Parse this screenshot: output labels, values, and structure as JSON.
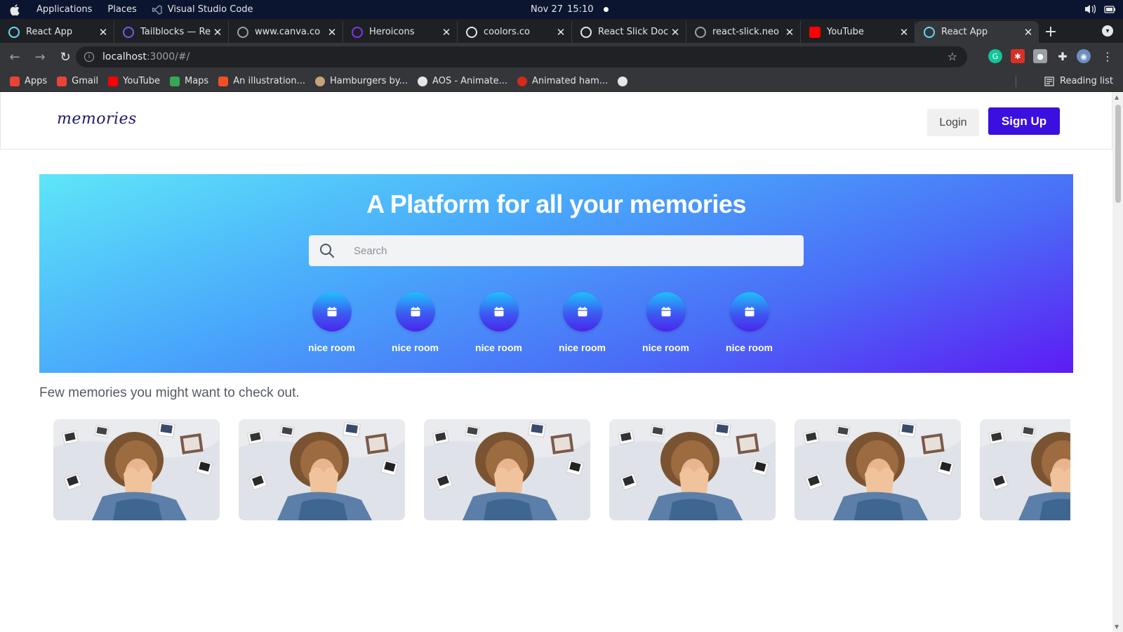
{
  "os": {
    "menu": [
      "Applications",
      "Places",
      "Visual Studio Code"
    ],
    "date": "Nov 27",
    "time": "15:10"
  },
  "browser": {
    "tabs": [
      {
        "title": "React App",
        "icon": "react-icon",
        "color": "#61dafb",
        "active": false
      },
      {
        "title": "Tailblocks — Re",
        "icon": "tailblocks-icon",
        "color": "#6d5ef0",
        "active": false
      },
      {
        "title": "www.canva.co",
        "icon": "canva-icon",
        "color": "#9aa0a6",
        "active": false
      },
      {
        "title": "Heroicons",
        "icon": "heroicons-icon",
        "color": "#7c3aed",
        "active": false
      },
      {
        "title": "coolors.co",
        "icon": "coolors-icon",
        "color": "#e6e6e6",
        "active": false
      },
      {
        "title": "React Slick Doc",
        "icon": "globe-icon",
        "color": "#e6e6e6",
        "active": false
      },
      {
        "title": "react-slick.neo",
        "icon": "globe-icon",
        "color": "#9aa0a6",
        "active": false
      },
      {
        "title": "YouTube",
        "icon": "youtube-icon",
        "color": "#ff0000",
        "active": false
      },
      {
        "title": "React App",
        "icon": "react-icon",
        "color": "#61dafb",
        "active": true
      }
    ],
    "url_host": "localhost",
    "url_path": ":3000/#/",
    "bookmarks": [
      {
        "label": "Apps",
        "icon": "apps-grid-icon",
        "color": "#ea4335"
      },
      {
        "label": "Gmail",
        "icon": "gmail-icon",
        "color": "#ea4335"
      },
      {
        "label": "YouTube",
        "icon": "youtube-icon",
        "color": "#ff0000"
      },
      {
        "label": "Maps",
        "icon": "maps-icon",
        "color": "#34a853"
      },
      {
        "label": "An illustration...",
        "icon": "microsoft-icon",
        "color": "#f25022"
      },
      {
        "label": "Hamburgers by...",
        "icon": "hamburger-site-icon",
        "color": "#c9a27a"
      },
      {
        "label": "AOS - Animate...",
        "icon": "globe-icon",
        "color": "#e6e6e6"
      },
      {
        "label": "Animated ham...",
        "icon": "animated-ham-icon",
        "color": "#d62a1a"
      },
      {
        "label": "",
        "icon": "globe-icon",
        "color": "#e6e6e6"
      }
    ],
    "reading_list": "Reading list"
  },
  "site": {
    "logo": "memories",
    "login": "Login",
    "signup": "Sign Up",
    "hero_title": "A Platform for all your memories",
    "search_placeholder": "Search",
    "rooms": [
      "nice room",
      "nice room",
      "nice room",
      "nice room",
      "nice room",
      "nice room"
    ],
    "section_title": "Few memories you might want to check out.",
    "gallery_count_visible": 6
  },
  "colors": {
    "brand": "#3b0fe0",
    "hero_start": "#5ee6f8",
    "hero_end": "#5d1cf3"
  }
}
